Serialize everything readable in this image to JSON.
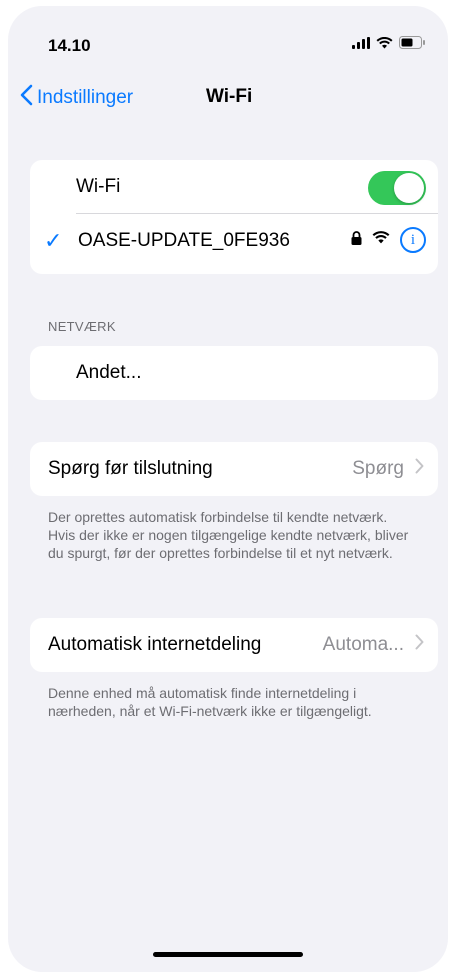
{
  "status_bar": {
    "time": "14.10",
    "icons": [
      "cellular-signal-icon",
      "wifi-icon",
      "battery-icon"
    ]
  },
  "nav": {
    "back_label": "Indstillinger",
    "title": "Wi-Fi"
  },
  "wifi_section": {
    "toggle_label": "Wi-Fi",
    "toggle_on": true,
    "connected_network": "OASE-UPDATE_0FE936",
    "info_glyph": "i"
  },
  "networks_section": {
    "header": "NETVÆRK",
    "other_label": "Andet..."
  },
  "ask_section": {
    "label": "Spørg før tilslutning",
    "value": "Spørg",
    "footer": "Der oprettes automatisk forbindelse til kendte netværk. Hvis der ikke er nogen tilgængelige kendte netværk, bliver du spurgt, før der oprettes forbindelse til et nyt netværk."
  },
  "hotspot_section": {
    "label": "Automatisk internetdeling",
    "value": "Automa...",
    "footer": "Denne enhed må automatisk finde internetdeling i nærheden, når et Wi-Fi-netværk ikke er tilgængeligt."
  },
  "colors": {
    "accent": "#0a7aff",
    "toggle_on": "#34c759",
    "background": "#f2f2f7",
    "secondary_text": "#6d6d72"
  }
}
